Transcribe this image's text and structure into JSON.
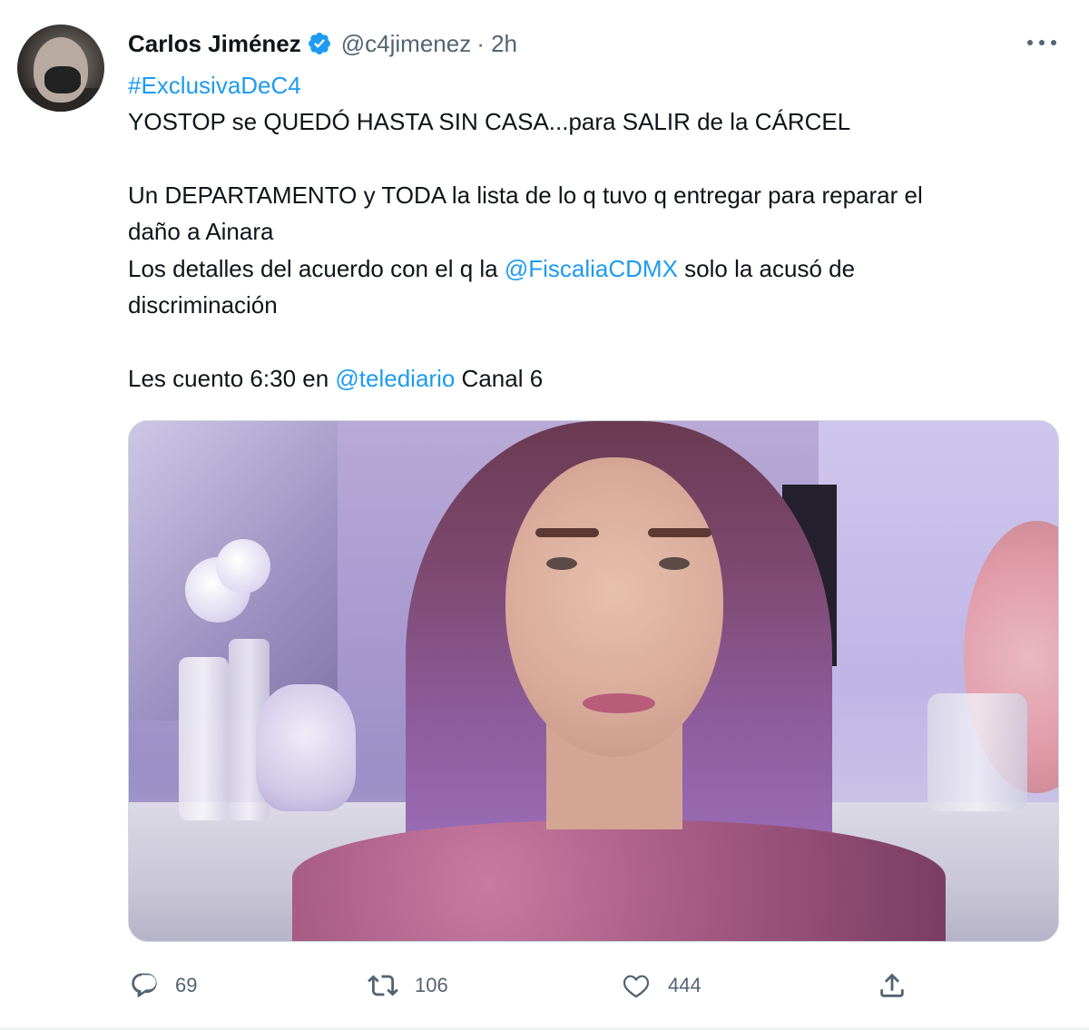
{
  "tweet": {
    "author": {
      "name": "Carlos Jiménez",
      "handle": "@c4jimenez",
      "time": "· 2h",
      "verified": true
    },
    "hashtag": "#ExclusivaDeC4",
    "line1": "YOSTOP se QUEDÓ HASTA SIN CASA...para SALIR de la CÁRCEL",
    "line2": "Un DEPARTAMENTO y TODA la lista de lo q tuvo q entregar para reparar el",
    "line3": "daño a Ainara",
    "line4_pre": "Los detalles del acuerdo con el q la ",
    "line4_mention": "@FiscaliaCDMX",
    "line4_post": " solo la acusó de",
    "line5": "discriminación",
    "line6_pre": "Les cuento 6:30 en ",
    "line6_mention": "@telediario",
    "line6_post": " Canal 6"
  },
  "actions": {
    "reply_count": "69",
    "retweet_count": "106",
    "like_count": "444"
  },
  "icons": {
    "verified": "verified-badge-icon",
    "more": "more-options-icon",
    "reply": "reply-icon",
    "retweet": "retweet-icon",
    "like": "like-icon",
    "share": "share-icon"
  },
  "colors": {
    "link": "#1d9bf0",
    "text": "#0f1419",
    "secondary": "#536471"
  }
}
